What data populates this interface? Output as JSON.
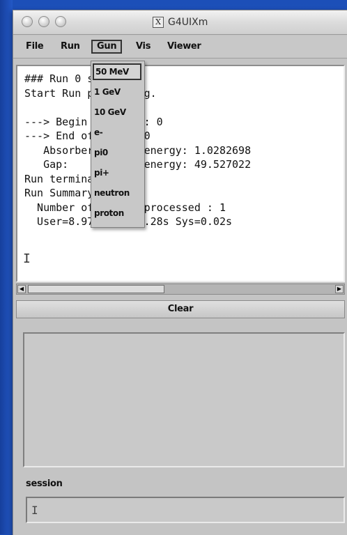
{
  "window": {
    "title": "G4UIXm",
    "title_icon": "x11-icon"
  },
  "menubar": {
    "items": [
      "File",
      "Run",
      "Gun",
      "Vis",
      "Viewer"
    ],
    "open": "Gun"
  },
  "gun_menu": {
    "items": [
      "50 MeV",
      "1 GeV",
      "10 GeV",
      "e-",
      "pi0",
      "pi+",
      "neutron",
      "proton"
    ],
    "selected": "50 MeV"
  },
  "output": {
    "text": "### Run 0 start.\nStart Run processing.\n\n---> Begin of event: 0\n---> End of event: 0\n   Absorber: total energy: 1.0282698\n   Gap:      total energy: 49.527022\nRun terminated.\nRun Summary\n  Number of events processed : 1\n  User=8.97s Real=9.28s Sys=0.02s",
    "cursor": "I"
  },
  "clear_button": {
    "label": "Clear"
  },
  "session": {
    "label": "session",
    "value": "",
    "caret": "I"
  },
  "colors": {
    "desktop": "#2a62d0",
    "window_bg": "#c4c4c4",
    "output_bg": "#ffffff"
  }
}
